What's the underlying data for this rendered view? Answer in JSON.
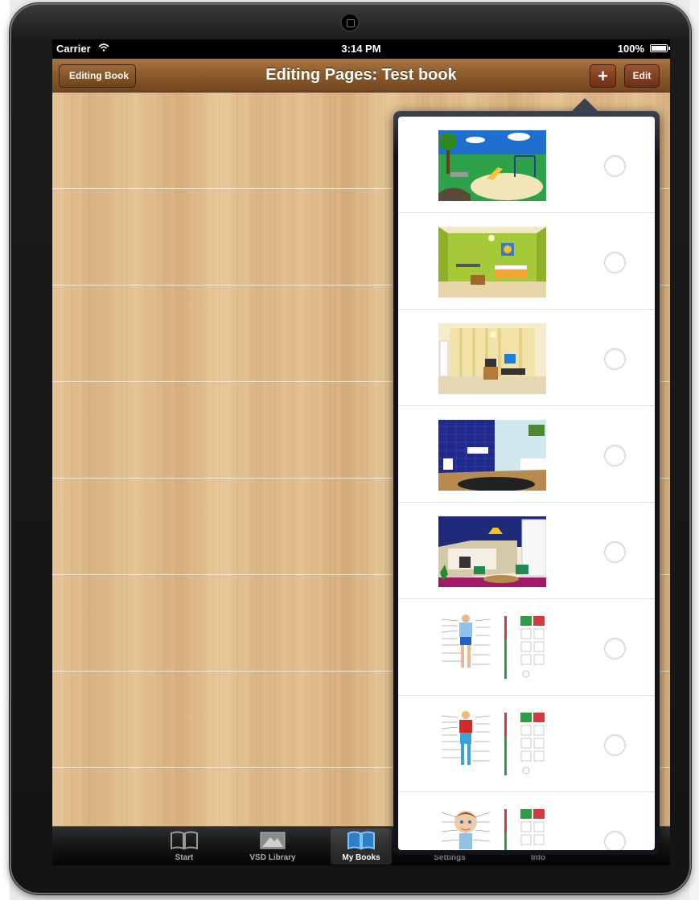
{
  "status": {
    "carrier": "Carrier",
    "time": "3:14 PM",
    "battery": "100%"
  },
  "nav": {
    "back_label": "Editing Book",
    "title": "Editing Pages: Test book",
    "add_label": "+",
    "edit_label": "Edit"
  },
  "pages": [
    {
      "name": "playground"
    },
    {
      "name": "bedroom-green"
    },
    {
      "name": "bedroom-striped"
    },
    {
      "name": "bathroom"
    },
    {
      "name": "kitchen"
    },
    {
      "name": "body-chart-boy"
    },
    {
      "name": "body-chart-girl"
    },
    {
      "name": "face-chart-boy"
    }
  ],
  "tabs": [
    {
      "label": "Start",
      "icon": "book-icon",
      "active": false
    },
    {
      "label": "VSD Library",
      "icon": "library-icon",
      "active": false
    },
    {
      "label": "My Books",
      "icon": "book-icon",
      "active": true
    },
    {
      "label": "Settings",
      "icon": "gear-icon",
      "active": false
    },
    {
      "label": "Info",
      "icon": "info-icon",
      "active": false
    }
  ],
  "colors": {
    "nav_wood": "#8a5a2c",
    "wood": "#e0bb8a",
    "popover": "#10151d",
    "yes": "#2e9b48",
    "no": "#d63b3b"
  }
}
